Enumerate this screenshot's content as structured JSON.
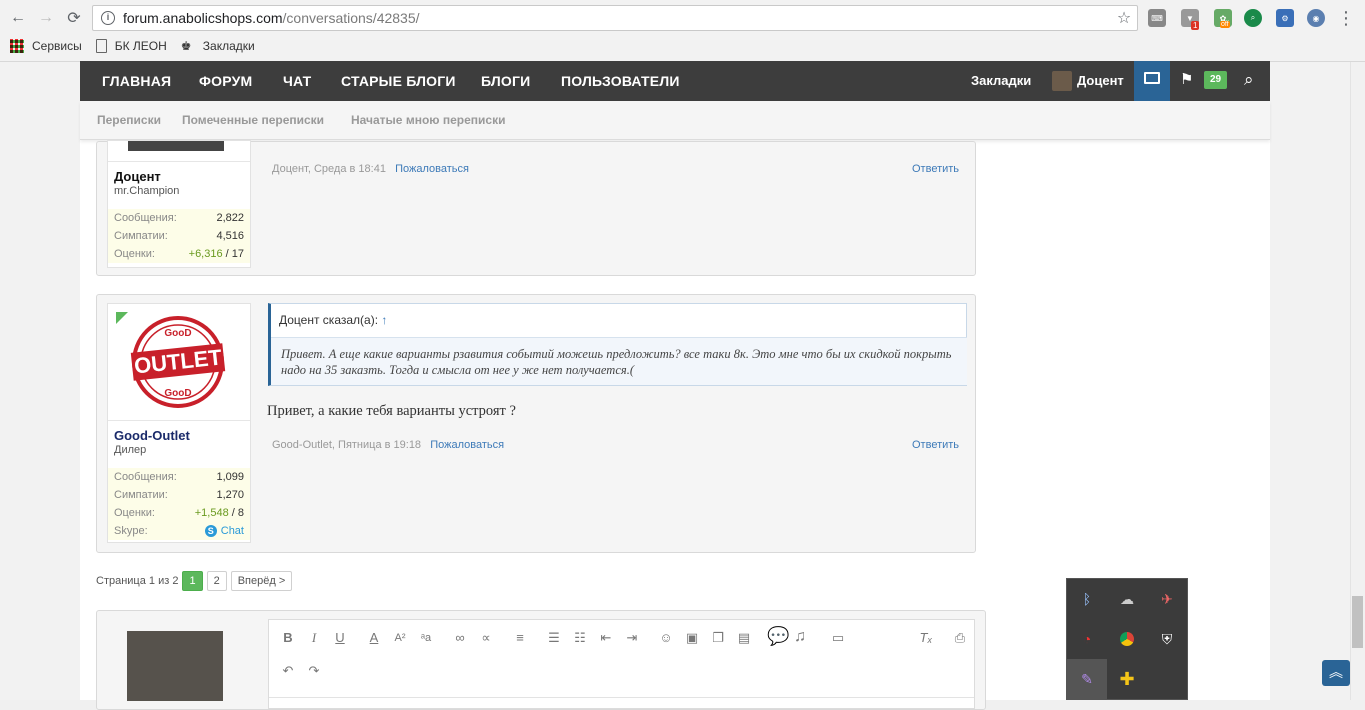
{
  "browser": {
    "url_domain": "forum.anabolicshops.com",
    "url_path": "/conversations/42835/",
    "bookmarks": [
      "Сервисы",
      "БК ЛЕОН",
      "Закладки"
    ],
    "ext_badge_1": "1",
    "ext_badge_2": "off"
  },
  "topnav": {
    "items": [
      "ГЛАВНАЯ",
      "ФОРУМ",
      "ЧАТ",
      "СТАРЫЕ БЛОГИ",
      "БЛОГИ",
      "ПОЛЬЗОВАТЕЛИ"
    ],
    "bookmarks": "Закладки",
    "user": "Доцент",
    "alerts_count": "29"
  },
  "subnav": [
    "Переписки",
    "Помеченные переписки",
    "Начатые мною переписки"
  ],
  "posts": [
    {
      "user": "Доцент",
      "title": "mr.Champion",
      "stats": [
        {
          "k": "Сообщения:",
          "v": "2,822"
        },
        {
          "k": "Симпатии:",
          "v": "4,516"
        },
        {
          "k": "Оценки:",
          "v_pos": "+6,316",
          "v_rest": " / 17"
        }
      ],
      "meta_author": "Доцент, Среда в 18:41",
      "report": "Пожаловаться",
      "reply": "Ответить"
    },
    {
      "user": "Good-Outlet",
      "title": "Дилер",
      "stats": [
        {
          "k": "Сообщения:",
          "v": "1,099"
        },
        {
          "k": "Симпатии:",
          "v": "1,270"
        },
        {
          "k": "Оценки:",
          "v_pos": "+1,548",
          "v_rest": " / 8"
        },
        {
          "k": "Skype:",
          "v": "Chat"
        }
      ],
      "quote_header": "Доцент сказал(а):",
      "quote_arrow": "↑",
      "quote_text": "Привет. А еще какие варианты рзавития событий можешь предложить? все таки 8к. Это мне что бы их скидкой покрыть надо на 35 заказть. Тогда и смысла от нее у же нет получается.(",
      "message": "Привет, а какие тебя варианты устроят ?",
      "meta_author": "Good-Outlet, Пятница в 19:18",
      "report": "Пожаловаться",
      "reply": "Ответить",
      "logo_top": "GooD",
      "logo_main": "OUTLET",
      "logo_bottom": "GooD"
    }
  ],
  "pager": {
    "label": "Страница 1 из 2",
    "pages": [
      "1",
      "2"
    ],
    "next": "Вперёд >"
  },
  "colors": {
    "nav": "#3d3d3d",
    "accent": "#2a6496",
    "green": "#5cb85c",
    "link": "#3d7ab8"
  }
}
